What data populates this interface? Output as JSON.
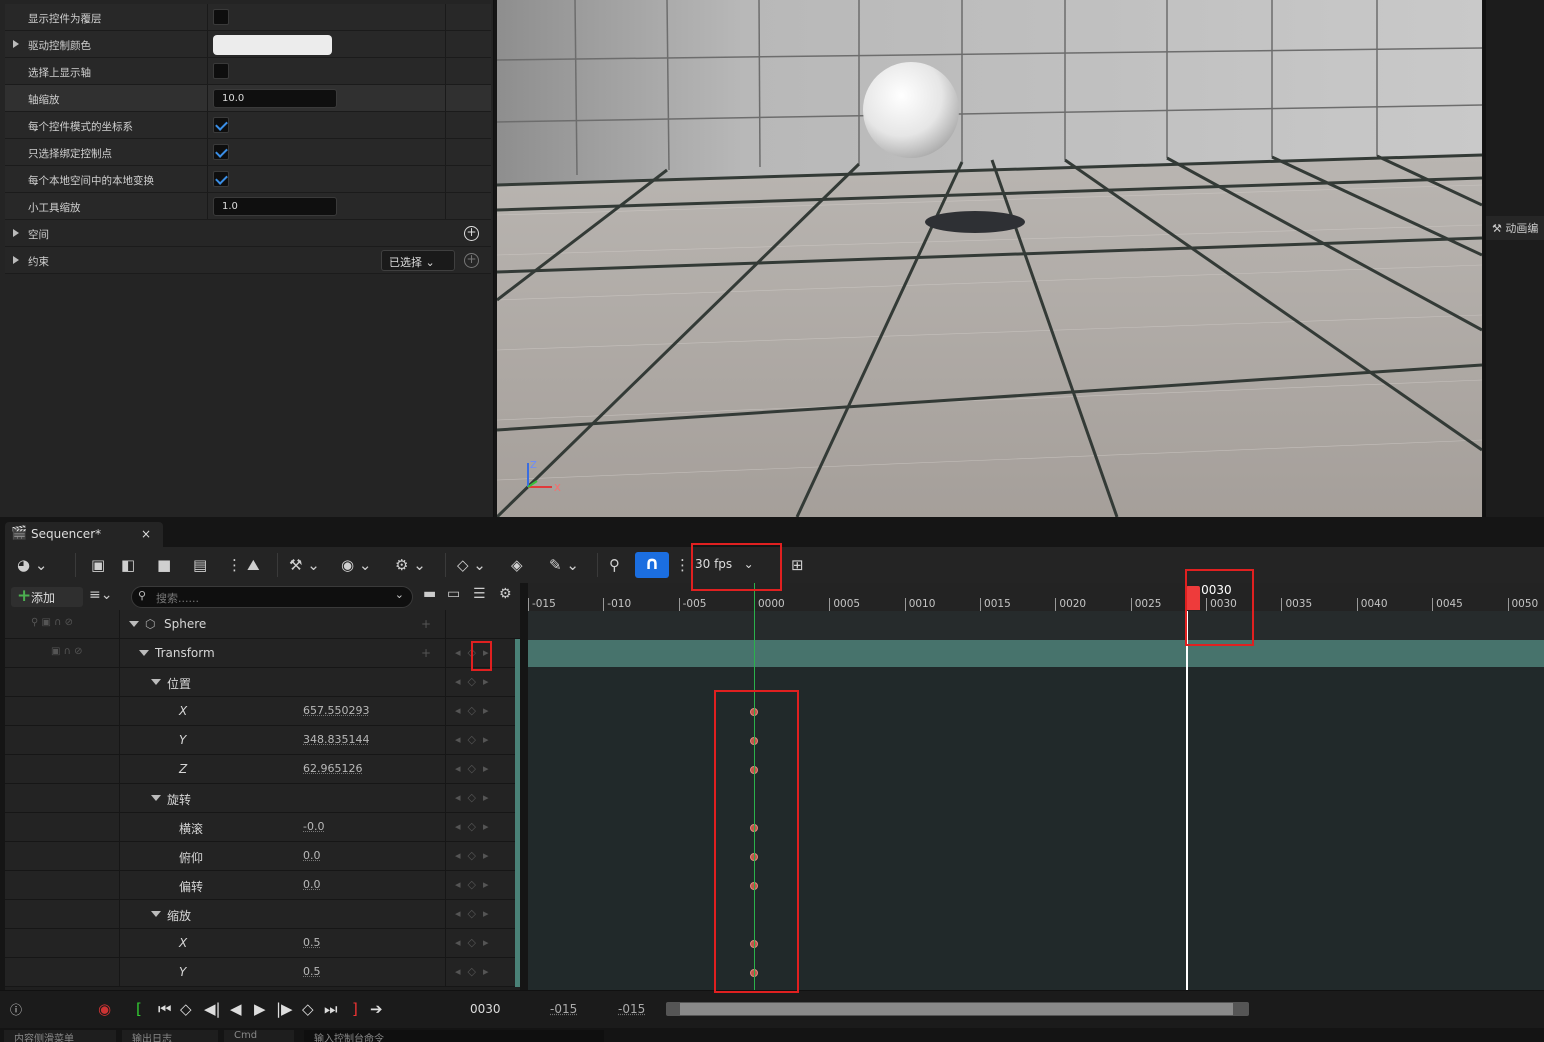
{
  "details": {
    "rows": [
      {
        "label": "显示控件为覆层",
        "control": "checkbox",
        "checked": false
      },
      {
        "label": "驱动控制颜色",
        "control": "color",
        "expandable": true
      },
      {
        "label": "选择上显示轴",
        "control": "checkbox",
        "checked": false
      },
      {
        "label": "轴缩放",
        "control": "number",
        "value": "10.0"
      },
      {
        "label": "每个控件模式的坐标系",
        "control": "checkbox",
        "checked": true
      },
      {
        "label": "只选择绑定控制点",
        "control": "checkbox",
        "checked": true
      },
      {
        "label": "每个本地空间中的本地变换",
        "control": "checkbox",
        "checked": true
      },
      {
        "label": "小工具缩放",
        "control": "number",
        "value": "1.0"
      }
    ],
    "space_label": "空间",
    "constraint_label": "约束",
    "selected_dropdown": "已选择"
  },
  "viewport": {
    "axis_z": "Z",
    "axis_x": "X"
  },
  "right_strip": {
    "tab_label": "动画编"
  },
  "sequencer": {
    "tab_title": "Sequencer*",
    "close": "×",
    "fps": "30 fps",
    "add_label": "添加",
    "search_placeholder": "搜索......",
    "tracks": [
      {
        "name": "Sphere",
        "indent": 0,
        "value": ""
      },
      {
        "name": "Transform",
        "indent": 1,
        "value": ""
      },
      {
        "name": "位置",
        "indent": 2,
        "value": ""
      },
      {
        "name": "X",
        "indent": 3,
        "value": "657.550293"
      },
      {
        "name": "Y",
        "indent": 3,
        "value": "348.835144"
      },
      {
        "name": "Z",
        "indent": 3,
        "value": "62.965126"
      },
      {
        "name": "旋转",
        "indent": 2,
        "value": ""
      },
      {
        "name": "横滚",
        "indent": 3,
        "value": "-0.0"
      },
      {
        "name": "俯仰",
        "indent": 3,
        "value": "0.0"
      },
      {
        "name": "偏转",
        "indent": 3,
        "value": "0.0"
      },
      {
        "name": "缩放",
        "indent": 2,
        "value": ""
      },
      {
        "name": "X",
        "indent": 3,
        "value": "0.5"
      },
      {
        "name": "Y",
        "indent": 3,
        "value": "0.5"
      }
    ],
    "ruler_ticks": [
      "-015",
      "-010",
      "-005",
      "0000",
      "0005",
      "0010",
      "0015",
      "0020",
      "0025",
      "0030",
      "0035",
      "0040",
      "0045",
      "0050"
    ],
    "current_frame": "0030",
    "playhead_frame": 30,
    "keyframe_frame": 0,
    "transport_frame": "0030",
    "range_start": "-015",
    "range_end": "-015"
  },
  "bottom_tabs": [
    "内容侧滑菜单",
    "输出日志",
    "Cmd",
    "输入控制台命令"
  ],
  "colors": {
    "accent": "#1b6ee0",
    "playhead": "#ee3b3b",
    "transform_track": "#47736c",
    "key": "#c2554a",
    "highlight_box": "#e02020"
  }
}
